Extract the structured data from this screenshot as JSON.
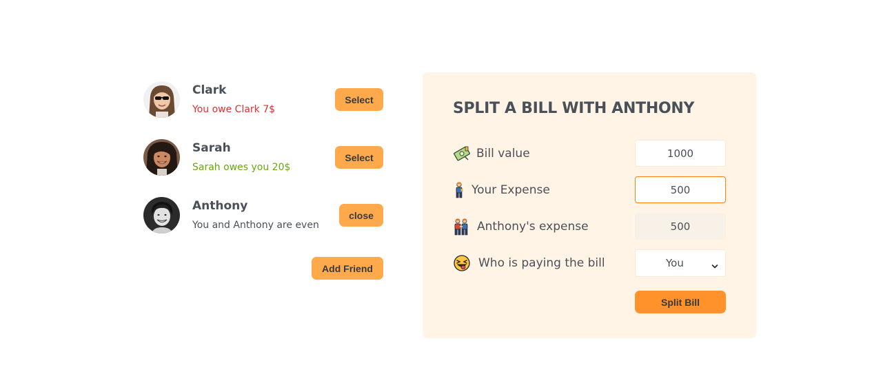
{
  "friends": [
    {
      "name": "Clark",
      "status": "You owe Clark 7$",
      "status_type": "owe",
      "button_label": "Select",
      "avatar": "man-with-sunglasses"
    },
    {
      "name": "Sarah",
      "status": "Sarah owes you 20$",
      "status_type": "owed",
      "button_label": "Select",
      "avatar": "smiling-woman"
    },
    {
      "name": "Anthony",
      "status": "You and Anthony are even",
      "status_type": "even",
      "button_label": "close",
      "avatar": "smiling-man"
    }
  ],
  "add_friend_label": "Add Friend",
  "split_form": {
    "title": "SPLIT A BILL WITH ANTHONY",
    "bill_value": {
      "icon": "money-icon",
      "label": "Bill value",
      "value": "1000"
    },
    "your_expense": {
      "icon": "person-standing-icon",
      "label": "Your Expense",
      "value": "500"
    },
    "friend_expense": {
      "icon": "two-people-icon",
      "label": "Anthony's expense",
      "value": "500"
    },
    "payer": {
      "icon": "tongue-face-icon",
      "label": "Who is paying the bill",
      "selected": "You"
    },
    "submit_label": "Split Bill"
  },
  "colors": {
    "accent": "#ffa94d",
    "accent_strong": "#ff922b",
    "form_bg": "#fff4e6",
    "owe_red": "#e03131",
    "owed_green": "#66a80f",
    "text": "#495057"
  }
}
